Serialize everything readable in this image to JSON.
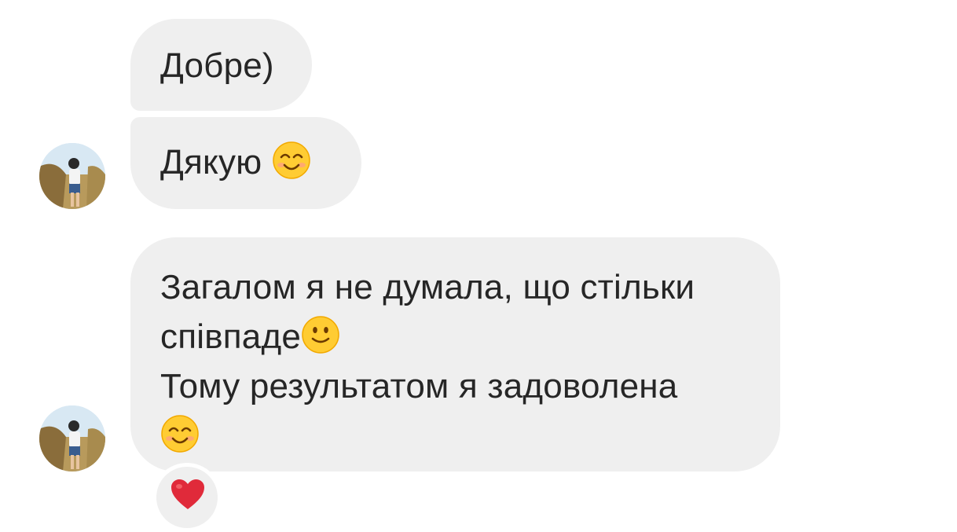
{
  "messages": [
    {
      "text": "Добре)"
    },
    {
      "text": "Дякую",
      "emoji": "smiling-face-with-smiling-eyes"
    },
    {
      "line1": "Загалом я не думала, що стільки",
      "line2": "співпаде",
      "line2_emoji": "slightly-smiling-face",
      "line3": "Тому результатом я задоволена",
      "line4_emoji": "smiling-face-with-smiling-eyes"
    }
  ],
  "reaction": {
    "emoji": "red-heart"
  },
  "colors": {
    "bubble": "#efefef",
    "text": "#262626",
    "background": "#ffffff",
    "heart": "#e02a3a",
    "emoji_face": "#ffcc33"
  }
}
